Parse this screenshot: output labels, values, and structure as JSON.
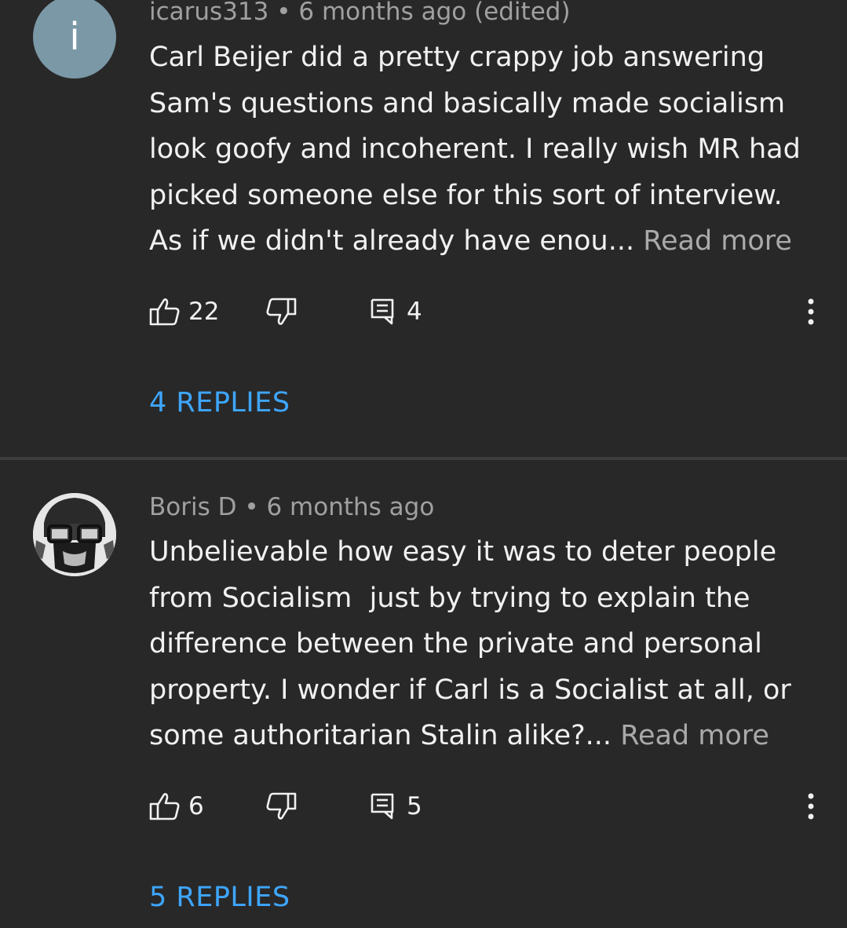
{
  "colors": {
    "background": "#282828",
    "text": "#f1f1f1",
    "meta_text": "#a0a0a0",
    "link": "#3ea6ff",
    "avatar_1": "#7b98a6"
  },
  "comments": [
    {
      "avatar_letter": "i",
      "author": "icarus313",
      "separator": "•",
      "time": "6 months ago (edited)",
      "text": "Carl Beijer did a pretty crappy job answering Sam's questions and basically made socialism look goofy and incoherent. I really wish MR had picked someone else for this sort of interview. As if we didn't already have enou...",
      "read_more": "Read more",
      "likes": "22",
      "reply_count": "4",
      "replies_label": "4 REPLIES",
      "icons": {
        "like": "thumbs-up-icon",
        "dislike": "thumbs-down-icon",
        "reply": "comment-icon",
        "menu": "more-vert-icon"
      }
    },
    {
      "avatar_letter": "",
      "author": "Boris D",
      "separator": "•",
      "time": "6 months ago",
      "text": "Unbelievable how easy it was to deter people from Socialism  just by trying to explain the difference between the private and personal property. I wonder if Carl is a Socialist at all, or some authoritarian Stalin alike?...",
      "read_more": "Read more",
      "likes": "6",
      "reply_count": "5",
      "replies_label": "5 REPLIES",
      "icons": {
        "like": "thumbs-up-icon",
        "dislike": "thumbs-down-icon",
        "reply": "comment-icon",
        "menu": "more-vert-icon"
      }
    }
  ]
}
